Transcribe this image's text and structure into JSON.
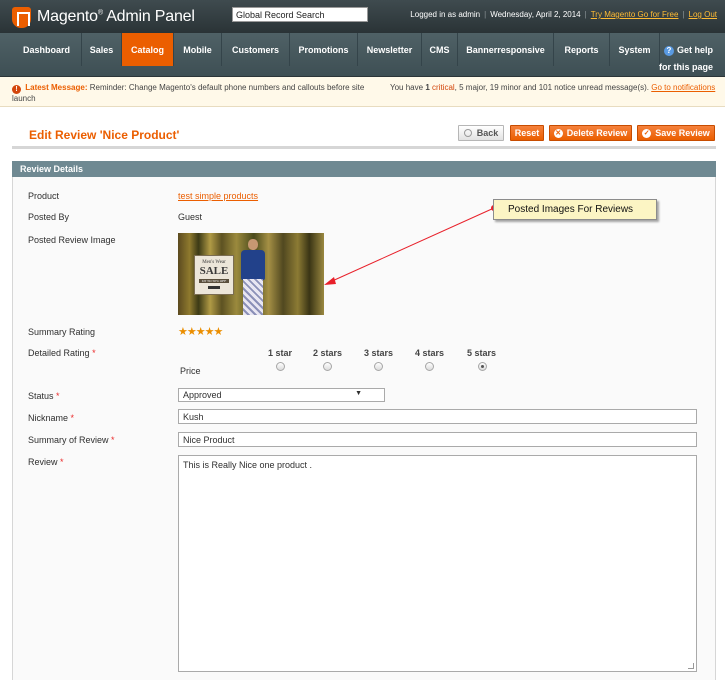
{
  "header": {
    "app_title": "Magento",
    "app_title_rest": " Admin Panel",
    "search_value": "Global Record Search",
    "logged_in": "Logged in as admin",
    "date": "Wednesday, April 2, 2014",
    "try_link": "Try Magento Go for Free",
    "logout": "Log Out"
  },
  "nav": {
    "items": [
      "Dashboard",
      "Sales",
      "Catalog",
      "Mobile",
      "Customers",
      "Promotions",
      "Newsletter",
      "CMS",
      "Bannerresponsive",
      "Reports",
      "System"
    ],
    "active": "Catalog",
    "help_line1": "Get help",
    "help_line2": "for this page"
  },
  "message": {
    "title": "Latest Message:",
    "text": "Reminder: Change Magento's default phone numbers and callouts before site launch",
    "summary_prefix": "You have",
    "critical_count": "1",
    "critical_label": "critical",
    "rest": ", 5 major, 19 minor and 101 notice unread message(s).",
    "link": "Go to notifications"
  },
  "page": {
    "title": "Edit Review 'Nice Product'",
    "buttons": {
      "back": "Back",
      "reset": "Reset",
      "delete": "Delete Review",
      "save": "Save Review"
    }
  },
  "section": {
    "title": "Review Details"
  },
  "form": {
    "product_label": "Product",
    "product_value": "test simple products",
    "posted_by_label": "Posted By",
    "posted_by_value": "Guest",
    "image_label": "Posted Review Image",
    "image_sign": {
      "line1": "Men's Wear",
      "line2": "SALE",
      "line3": "UP TO 50% OFF"
    },
    "summary_rating_label": "Summary Rating",
    "summary_rating_value": 5,
    "stars_text": "★★★★★",
    "detailed_rating_label": "Detailed Rating",
    "required_mark": "*",
    "rating_columns": [
      "1 star",
      "2 stars",
      "3 stars",
      "4 stars",
      "5 stars"
    ],
    "rating_row_label": "Price",
    "rating_selected": "5 stars",
    "status_label": "Status",
    "status_value": "Approved",
    "nickname_label": "Nickname",
    "nickname_value": "Kush",
    "summary_label": "Summary of Review",
    "summary_value": "Nice Product",
    "review_label": "Review",
    "review_value": "This is Really Nice one product ."
  },
  "annotation": {
    "text": "Posted Images For Reviews",
    "color": "#e8202a"
  },
  "colors": {
    "accent": "#eb5e00",
    "nav_bg": "#4f6166",
    "section_head": "#6f8992"
  }
}
